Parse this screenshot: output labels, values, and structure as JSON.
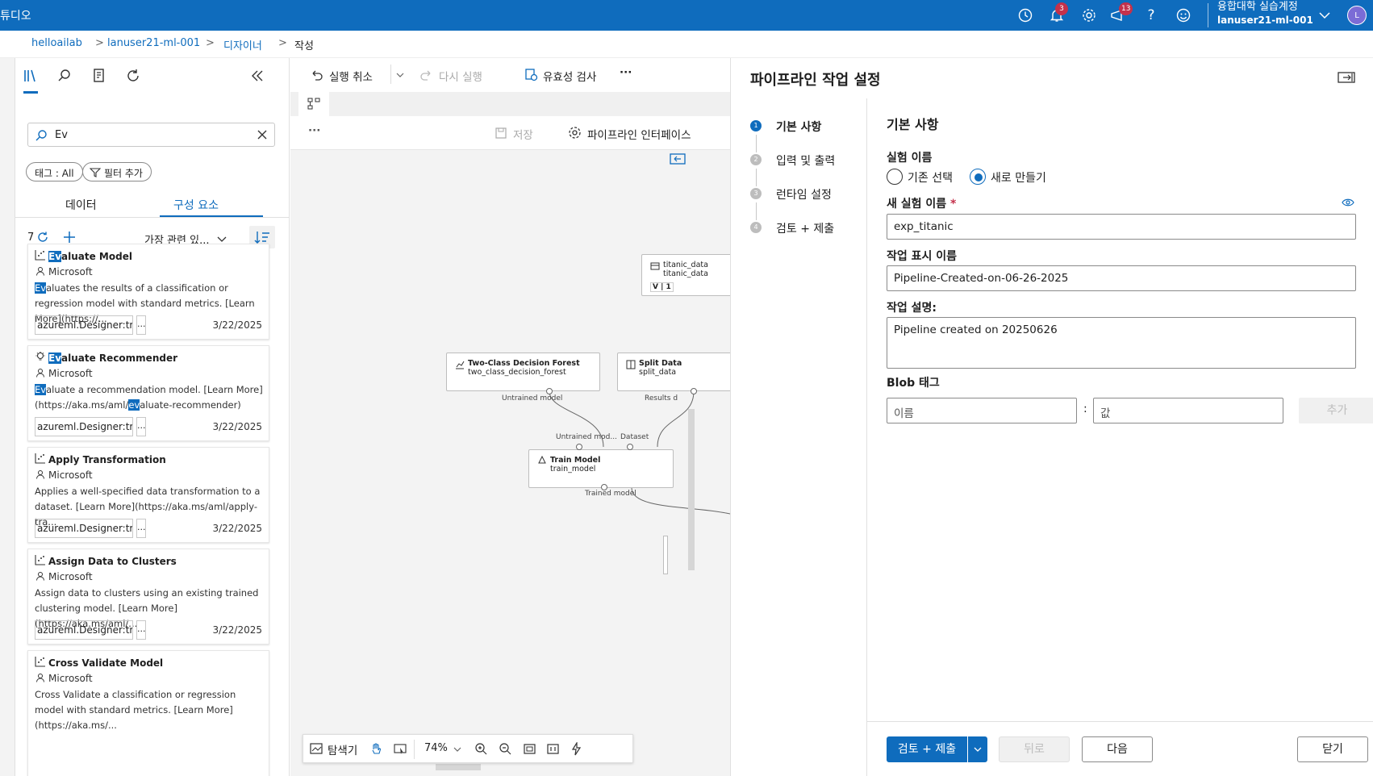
{
  "topbar": {
    "brand": "튜디오",
    "notifications_count": "3",
    "feedback_count": "13",
    "account_org": "융합대학 실습계정",
    "account_user": "lanuser21-ml-001",
    "avatar_initial": "L",
    "icons": [
      "history-icon",
      "bell-icon",
      "gear-icon",
      "feedback-icon",
      "help-icon",
      "smiley-icon",
      "chevron-down-icon"
    ]
  },
  "breadcrumb": {
    "items": [
      "helloailab",
      "lanuser21-ml-001",
      "디자이너",
      "작성"
    ],
    "sep": ">"
  },
  "leftpanel": {
    "search_value": "Ev",
    "chip_tag": "태그 : All",
    "chip_filter": "필터 추가",
    "seg_data": "데이터",
    "seg_components": "구성 요소",
    "count": "7",
    "sort_label": "가장 관련 있...",
    "cards": [
      {
        "title_hl": "Ev",
        "title_rest": "aluate Model",
        "publisher": "Microsoft",
        "desc_hl": "Ev",
        "desc": "aluates the results of a classification or regression model with standard metrics. [Learn More](https://...",
        "tag": "azureml.Designer:true",
        "more": "...",
        "date": "3/22/2025"
      },
      {
        "title_hl": "Ev",
        "title_rest": "aluate Recommender",
        "publisher": "Microsoft",
        "desc_hl": "Ev",
        "desc_a": "aluate a recommendation model. [Learn More](https://aka.ms/aml/",
        "desc_hl2": "ev",
        "desc_b": "aluate-recommender)",
        "tag": "azureml.Designer:true",
        "more": "...",
        "date": "3/22/2025"
      },
      {
        "title": "Apply Transformation",
        "publisher": "Microsoft",
        "desc": "Applies a well-specified data transformation to a dataset. [Learn More](https://aka.ms/aml/apply-tra...",
        "tag": "azureml.Designer:true",
        "more": "...",
        "date": "3/22/2025"
      },
      {
        "title": "Assign Data to Clusters",
        "publisher": "Microsoft",
        "desc": "Assign data to clusters using an existing trained clustering model. [Learn More](https://aka.ms/aml/...",
        "tag": "azureml.Designer:true",
        "more": "...",
        "date": "3/22/2025"
      },
      {
        "title": "Cross Validate Model",
        "publisher": "Microsoft",
        "desc": "Cross Validate a classification or regression model with standard metrics. [Learn More](https://aka.ms/...",
        "tag": "",
        "more": "",
        "date": ""
      }
    ]
  },
  "canvas": {
    "undo": "실행 취소",
    "redo": "다시 실행",
    "validate": "유효성 검사",
    "more": "···",
    "save": "저장",
    "pipeline_interface": "파이프라인 인터페이스",
    "zoom": "74%",
    "explorer": "탐색기",
    "nodes": {
      "titanic_title": "titanic_data",
      "titanic_sub": "titanic_data",
      "titanic_ver": "V | 1",
      "forest_title": "Two-Class Decision Forest",
      "forest_sub": "two_class_decision_forest",
      "split_title": "Split Data",
      "split_sub": "split_data",
      "train_title": "Train Model",
      "train_sub": "train_model"
    },
    "ports": {
      "untrained_model": "Untrained model",
      "results": "Results d",
      "untrained_mod": "Untrained mod...",
      "dataset": "Dataset",
      "trained_model": "Trained model"
    }
  },
  "rightpanel": {
    "title": "파이프라인 작업 설정",
    "steps": [
      {
        "num": "1",
        "label": "기본 사항"
      },
      {
        "num": "2",
        "label": "입력 및 출력"
      },
      {
        "num": "3",
        "label": "런타임 설정"
      },
      {
        "num": "4",
        "label": "검토 + 제출"
      }
    ],
    "section": "기본 사항",
    "experiment_label": "실험 이름",
    "radio_existing": "기존 선택",
    "radio_new": "새로 만들기",
    "new_exp_label": "새 실험 이름",
    "required_mark": "*",
    "new_exp_value": "exp_titanic",
    "display_name_label": "작업 표시 이름",
    "display_name_value": "Pipeline-Created-on-06-26-2025",
    "desc_label": "작업 설명:",
    "desc_value": "Pipeline created on 20250626",
    "blob_label": "Blob 태그",
    "tag_name_placeholder": "이름",
    "tag_colon": ":",
    "tag_value_placeholder": "값",
    "add_button": "추가",
    "btn_review": "검토 + 제출",
    "btn_back": "뒤로",
    "btn_next": "다음",
    "btn_close": "닫기"
  },
  "colors": {
    "accent": "#0f6cbd",
    "badge": "#c4314b"
  }
}
